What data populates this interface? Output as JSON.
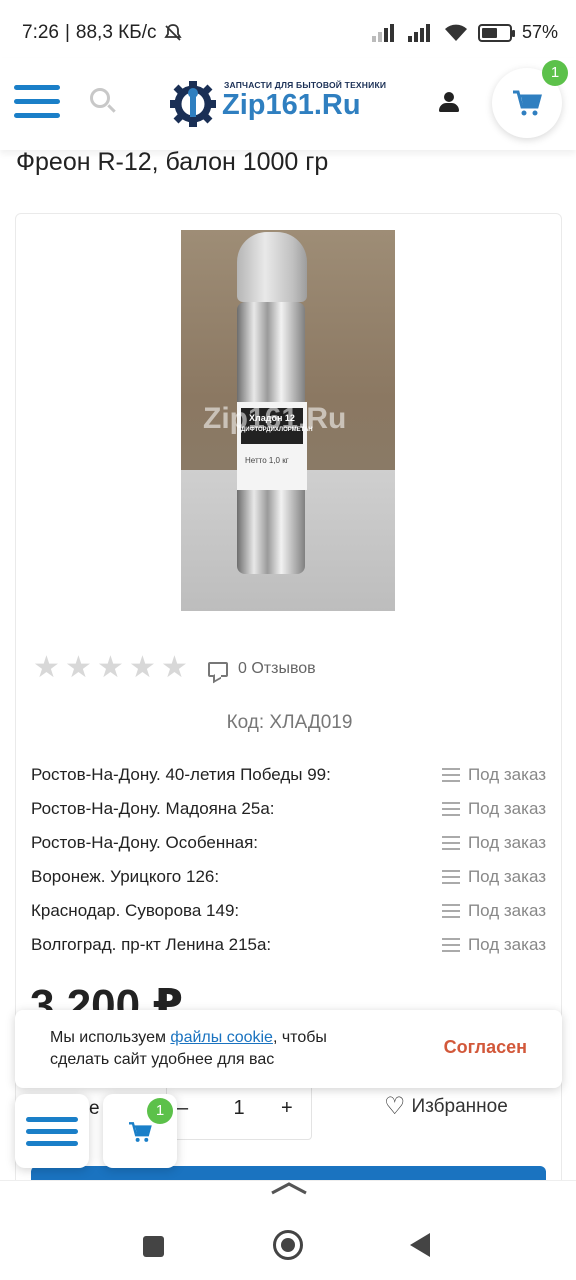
{
  "status_bar": {
    "time": "7:26",
    "speed": "88,3 КБ/с",
    "battery": "57%",
    "battery_level": 0.57
  },
  "header": {
    "logo_tagline": "ЗАПЧАСТИ ДЛЯ БЫТОВОЙ ТЕХНИКИ",
    "logo_name": "Zip161.Ru",
    "cart_count": "1"
  },
  "product": {
    "title": "Фреон R-12, балон 1000 гр",
    "photo": {
      "watermark": "Zip161.Ru",
      "label_line1": "Хладон 12",
      "label_line2": "ДИФТОРДИХЛОРМЕТАН",
      "label_weight": "Нетто 1,0 кг"
    },
    "rating": 0,
    "rating_max": 5,
    "reviews": "0 Отзывов",
    "code": "Код: ХЛАД019",
    "stores": [
      {
        "address": "Ростов-На-Дону. 40-летия Победы 99:",
        "status": "Под заказ"
      },
      {
        "address": "Ростов-На-Дону. Мадояна 25а:",
        "status": "Под заказ"
      },
      {
        "address": "Ростов-На-Дону. Особенная:",
        "status": "Под заказ"
      },
      {
        "address": "Воронеж. Урицкого 126:",
        "status": "Под заказ"
      },
      {
        "address": "Краснодар. Суворова 149:",
        "status": "Под заказ"
      },
      {
        "address": "Волгоград. пр-кт Ленина 215а:",
        "status": "Под заказ"
      }
    ],
    "price": "3 200 ₽",
    "quantity_label_fragment": "е",
    "quantity": "1",
    "minus": "–",
    "plus": "+",
    "favorite_label": "Избранное"
  },
  "cookie": {
    "text_before": "Мы используем ",
    "link_text": "файлы cookie",
    "text_after": ", чтобы сделать сайт удобнее для вас",
    "accept_label": "Согласен"
  },
  "floating": {
    "cart_count": "1"
  },
  "colors": {
    "brand_blue": "#1a7fc8",
    "button_blue": "#1a73c0",
    "badge_green": "#5cc14a",
    "accept_orange": "#d2583a"
  }
}
